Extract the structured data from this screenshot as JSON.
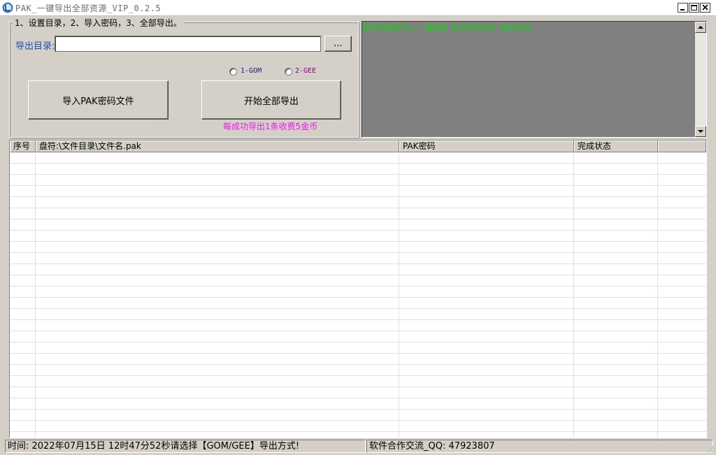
{
  "window": {
    "title": "PAK_一键导出全部资源_VIP_0.2.5"
  },
  "group": {
    "caption": "1、设置目录，2、导入密码，3、全部导出。",
    "export_dir_label": "导出目录:",
    "export_dir_value": "",
    "browse_label": "...",
    "import_button": "导入PAK密码文件",
    "export_all_button": "开始全部导出",
    "radio_gom_label": "1-GOM",
    "radio_gee_label": "2-GEE",
    "fee_note": "每成功导出1条收费5金币"
  },
  "log": {
    "message": "软件初始化中。。。请选择【GOM/GEE】导出方式!"
  },
  "table": {
    "columns": [
      "序号",
      "盘符:\\文件目录\\文件名.pak",
      "PAK密码",
      "完成状态",
      ""
    ]
  },
  "status": {
    "left": "时间: 2022年07月15日 12时47分52秒请选择【GOM/GEE】导出方式!",
    "right": "软件合作交流_QQ: 47923807"
  },
  "colors": {
    "accent_label": "#1f4fb4",
    "fee_note": "#ee18ee",
    "log_text": "#00e000",
    "log_bg": "#808080",
    "window_bg": "#d4d0c8"
  }
}
